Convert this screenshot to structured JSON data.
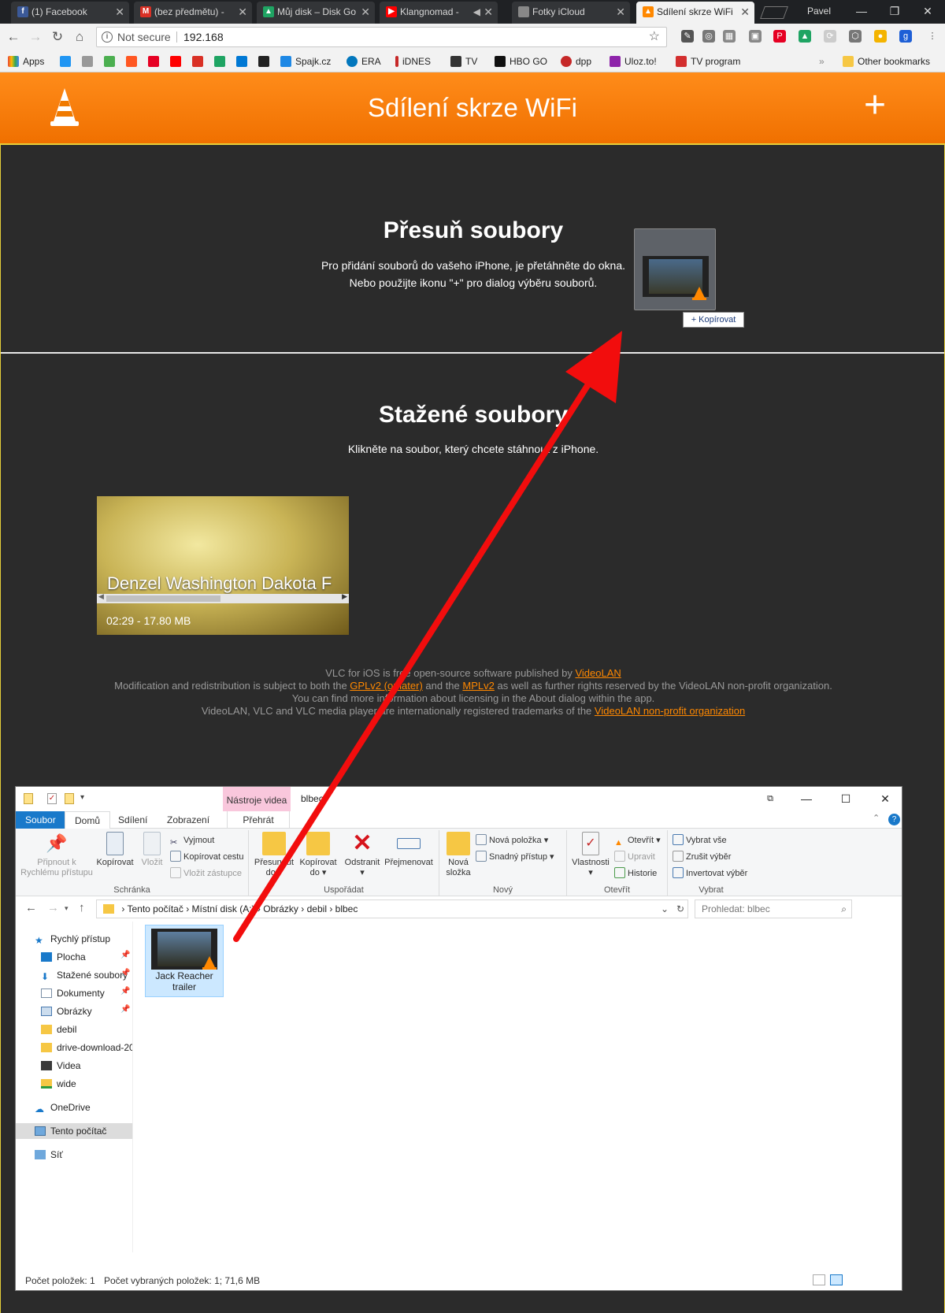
{
  "browser": {
    "tabs": [
      {
        "label": "(1) Facebook",
        "icon": "facebook-icon",
        "color": "#3b5998",
        "glyph": "f"
      },
      {
        "label": "(bez předmětu) - ",
        "icon": "gmail-icon",
        "color": "#d93025",
        "glyph": "M"
      },
      {
        "label": "Můj disk – Disk Go",
        "icon": "drive-icon",
        "color": "#1fa463",
        "glyph": "▲"
      },
      {
        "label": "Klangnomad - ",
        "icon": "youtube-icon",
        "color": "#ff0000",
        "glyph": "▶"
      },
      {
        "label": "Fotky iCloud",
        "icon": "apple-icon",
        "color": "#888888",
        "glyph": ""
      },
      {
        "label": "Sdílení skrze WiFi",
        "icon": "vlc-icon",
        "color": "#ff8800",
        "glyph": "▲"
      }
    ],
    "profile": "Pavel",
    "omnibox": {
      "security": "Not secure",
      "url": "192.168"
    },
    "bookmarks": [
      {
        "label": "Apps",
        "color": "#ea4335"
      },
      {
        "label": "",
        "color": "#2196f3"
      },
      {
        "label": "",
        "color": "#999999"
      },
      {
        "label": "",
        "color": "#4caf50"
      },
      {
        "label": "",
        "color": "#ff5722"
      },
      {
        "label": "",
        "color": "#e60023"
      },
      {
        "label": "",
        "color": "#ff0000"
      },
      {
        "label": "",
        "color": "#d93025"
      },
      {
        "label": "",
        "color": "#1fa463"
      },
      {
        "label": "",
        "color": "#0078d4"
      },
      {
        "label": "",
        "color": "#222222"
      },
      {
        "label": "Spajk.cz",
        "color": "#1e88e5"
      },
      {
        "label": "ERA",
        "color": "#0277bd"
      },
      {
        "label": "iDNES",
        "color": "#c62828"
      },
      {
        "label": "TV",
        "color": "#333333"
      },
      {
        "label": "HBO GO",
        "color": "#111111"
      },
      {
        "label": "dpp",
        "color": "#c62828"
      },
      {
        "label": "Uloz.to!",
        "color": "#8e24aa"
      },
      {
        "label": "TV program",
        "color": "#d32f2f"
      }
    ],
    "other_bookmarks": "Other bookmarks"
  },
  "vlc": {
    "header_title": "Sdílení skrze WiFi",
    "plus": "+",
    "upload": {
      "title": "Přesuň soubory",
      "line1": "Pro přidání souborů do vašeho iPhone, je přetáhněte do okna.",
      "line2": "Nebo použijte ikonu \"+\" pro dialog výběru souborů.",
      "drag_tooltip": "+ Kopírovat"
    },
    "downloads": {
      "title": "Stažené soubory",
      "subtitle": "Klikněte na soubor, který chcete stáhnout z iPhone.",
      "video_title": "Denzel Washington Dakota F",
      "video_meta": "02:29 - 17.80 MB"
    },
    "footer": {
      "l1_pre": "VLC for iOS is free open-source software published by ",
      "l1_link": "VideoLAN",
      "l2_pre": "Modification and redistribution is subject to both the ",
      "l2_link1": "GPLv2 (or later)",
      "l2_mid": " and the ",
      "l2_link2": "MPLv2",
      "l2_post": " as well as further rights reserved by the VideoLAN non-profit organization.",
      "l3": "You can find more information about licensing in the About dialog within the app.",
      "l4_pre": "VideoLAN, VLC and VLC media player are internationally registered trademarks of the ",
      "l4_link": "VideoLAN non-profit organization"
    }
  },
  "explorer": {
    "context_tab": "Nástroje videa",
    "window_name": "blbec",
    "tabs": {
      "file": "Soubor",
      "home": "Domů",
      "share": "Sdílení",
      "view": "Zobrazení",
      "play": "Přehrát"
    },
    "ribbon": {
      "pin": "Připnout k Rychlému přístupu",
      "copy": "Kopírovat",
      "paste": "Vložit",
      "cut": "Vyjmout",
      "copy_path": "Kopírovat cestu",
      "paste_shortcut": "Vložit zástupce",
      "group_clipboard": "Schránka",
      "move_to": "Přesunout do",
      "copy_to": "Kopírovat do",
      "delete": "Odstranit",
      "rename": "Přejmenovat",
      "group_organize": "Uspořádat",
      "new_folder": "Nová složka",
      "new_item": "Nová položka",
      "easy_access": "Snadný přístup",
      "group_new": "Nový",
      "properties": "Vlastnosti",
      "open": "Otevřít",
      "edit": "Upravit",
      "history": "Historie",
      "group_open": "Otevřít",
      "select_all": "Vybrat vše",
      "select_none": "Zrušit výběr",
      "invert": "Invertovat výběr",
      "group_select": "Vybrat"
    },
    "path": [
      "Tento počítač",
      "Místní disk (A:)",
      "Obrázky",
      "debil",
      "blbec"
    ],
    "search_placeholder": "Prohledat: blbec",
    "nav": [
      {
        "label": "Rychlý přístup",
        "pinned": false
      },
      {
        "label": "Plocha",
        "pinned": true
      },
      {
        "label": "Stažené soubory",
        "pinned": true
      },
      {
        "label": "Dokumenty",
        "pinned": true
      },
      {
        "label": "Obrázky",
        "pinned": true
      },
      {
        "label": "debil",
        "pinned": false
      },
      {
        "label": "drive-download-20",
        "pinned": false
      },
      {
        "label": "Videa",
        "pinned": false
      },
      {
        "label": "wide",
        "pinned": false
      },
      {
        "label": "OneDrive",
        "pinned": false
      },
      {
        "label": "Tento počítač",
        "pinned": false
      },
      {
        "label": "Síť",
        "pinned": false
      }
    ],
    "file": {
      "name": "Jack Reacher trailer"
    },
    "status": {
      "count": "Počet položek: 1",
      "selected": "Počet vybraných položek: 1; 71,6 MB"
    }
  }
}
